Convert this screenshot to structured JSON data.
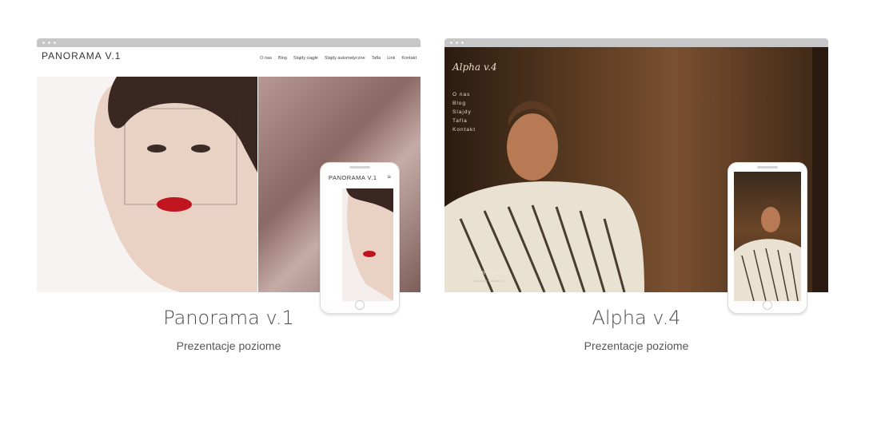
{
  "cards": [
    {
      "site_logo": "PANORAMA V.1",
      "nav": [
        "O nas",
        "Blog",
        "Slajdy ciągłe",
        "Slajdy automatyczne",
        "Tafla",
        "Link",
        "Kontakt"
      ],
      "phone_logo": "PANORAMA V.1",
      "phone_menu_icon": "≡",
      "title": "Panorama v.1",
      "subtitle": "Prezentacje poziome"
    },
    {
      "site_logo": "Alpha v.4",
      "nav": [
        "O nas",
        "Blog",
        "Slajdy",
        "Tafla",
        "Kontakt"
      ],
      "portfolio_label": "PORTFOLIO",
      "copyright": "Copyright © Alpha v.4",
      "title": "Alpha v.4",
      "subtitle": "Prezentacje poziome"
    }
  ],
  "colors": {
    "browser_bar": "#c7c7c7",
    "title_text": "#4b4b4b",
    "subtitle_text": "#555555"
  }
}
